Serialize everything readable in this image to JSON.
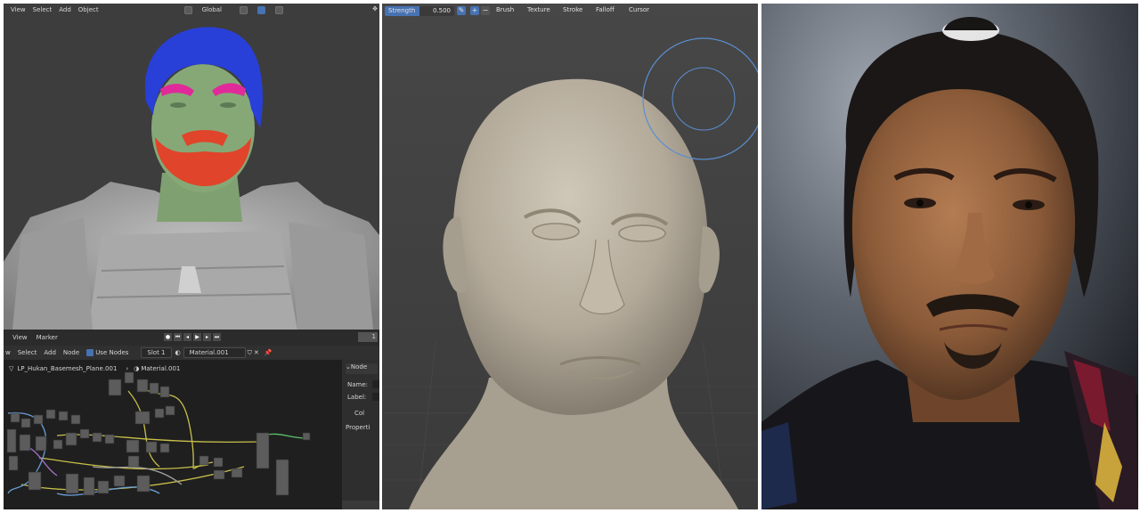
{
  "viewport_header": {
    "menus": [
      "View",
      "Select",
      "Add",
      "Object"
    ],
    "orientation": "Global"
  },
  "timeline": {
    "menus": [
      "View",
      "Marker"
    ],
    "current_frame": "1"
  },
  "node_editor": {
    "menus": [
      "w",
      "Select",
      "Add",
      "Node"
    ],
    "use_nodes_label": "Use Nodes",
    "slot": "Slot 1",
    "material": "Material.001",
    "breadcrumb_object": "LP_Hukan_Basemesh_Plane.001",
    "breadcrumb_material": "Material.001",
    "sidebar": {
      "section": "Node",
      "name_label": "Name:",
      "label_label": "Label:",
      "color_label": "Col",
      "properties_label": "Properti"
    }
  },
  "sculpt_header": {
    "strength_label": "Strength",
    "strength_value": "0.500",
    "strength_fraction": 0.5,
    "menus": [
      "Brush",
      "Texture",
      "Stroke",
      "Falloff",
      "Cursor"
    ]
  },
  "colors": {
    "accent": "#4772b3",
    "hair_mask": "#2840d8",
    "brow_mask": "#e02a9a",
    "beard_mask": "#e0442a",
    "skin_mask": "#86a877",
    "clay": "#b8b0a2"
  },
  "icons": [
    "orientation-icon",
    "snap-icon",
    "record-icon",
    "play-icon",
    "pin-icon",
    "material-sphere-icon"
  ]
}
